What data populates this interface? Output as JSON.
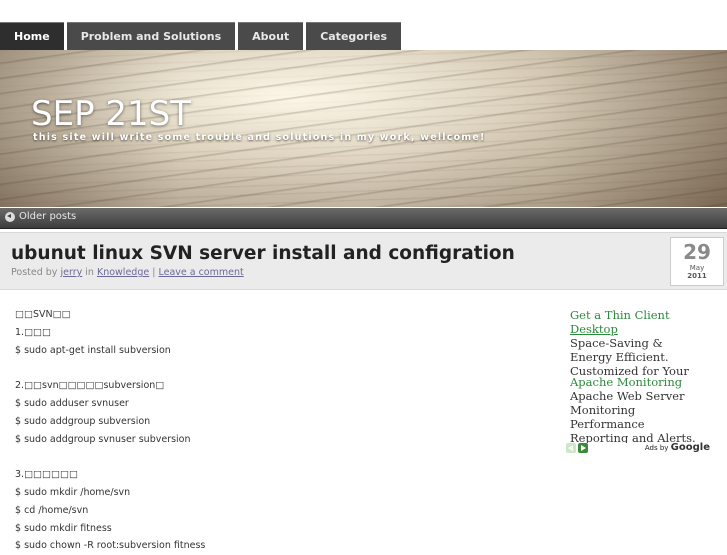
{
  "nav": {
    "items": [
      {
        "label": "Home",
        "active": true
      },
      {
        "label": "Problem and Solutions",
        "active": false
      },
      {
        "label": "About",
        "active": false
      },
      {
        "label": "Categories",
        "active": false
      }
    ]
  },
  "header": {
    "site_title": "SEP 21ST",
    "site_description": "this site will write some trouble and solutions in my work, wellcome!"
  },
  "pagination": {
    "older_label": "Older posts",
    "older_icon": "left-arrow-circle-icon"
  },
  "post": {
    "title": "ubunut linux SVN server install and configration",
    "meta_prefix": "Posted by",
    "author": "jerry",
    "meta_in": "in",
    "category": "Knowledge",
    "meta_sep": "|",
    "comment_link": "Leave a comment",
    "date": {
      "day": "29",
      "month": "May",
      "year": "2011"
    },
    "body_lines": [
      "□□SVN□□",
      "1.□□□",
      "$ sudo apt-get install subversion",
      "",
      "2.□□svn□□□□□subversion□",
      "$ sudo adduser svnuser",
      "$ sudo addgroup subversion",
      "$ sudo addgroup svnuser subversion",
      "",
      "3.□□□□□□",
      "$ sudo mkdir /home/svn",
      "$ cd /home/svn",
      "$ sudo mkdir fitness",
      "$ sudo chown -R root:subversion fitness"
    ]
  },
  "ads": {
    "items": [
      {
        "title_line1": "Get a Thin Client",
        "title_line2": "Desktop",
        "text": [
          "Space-Saving &",
          "Energy Efficient.",
          "Customized for Your"
        ]
      },
      {
        "title_line1": "Apache Monitoring",
        "title_line2": "",
        "text": [
          "Apache Web Server",
          "Monitoring",
          "Performance",
          "Reporting and Alerts."
        ]
      }
    ],
    "ads_by_label": "Ads by",
    "google_label": "Google",
    "colors": {
      "ad_title": "#2a8a3a",
      "arrow_active": "#3a8a3a"
    }
  }
}
